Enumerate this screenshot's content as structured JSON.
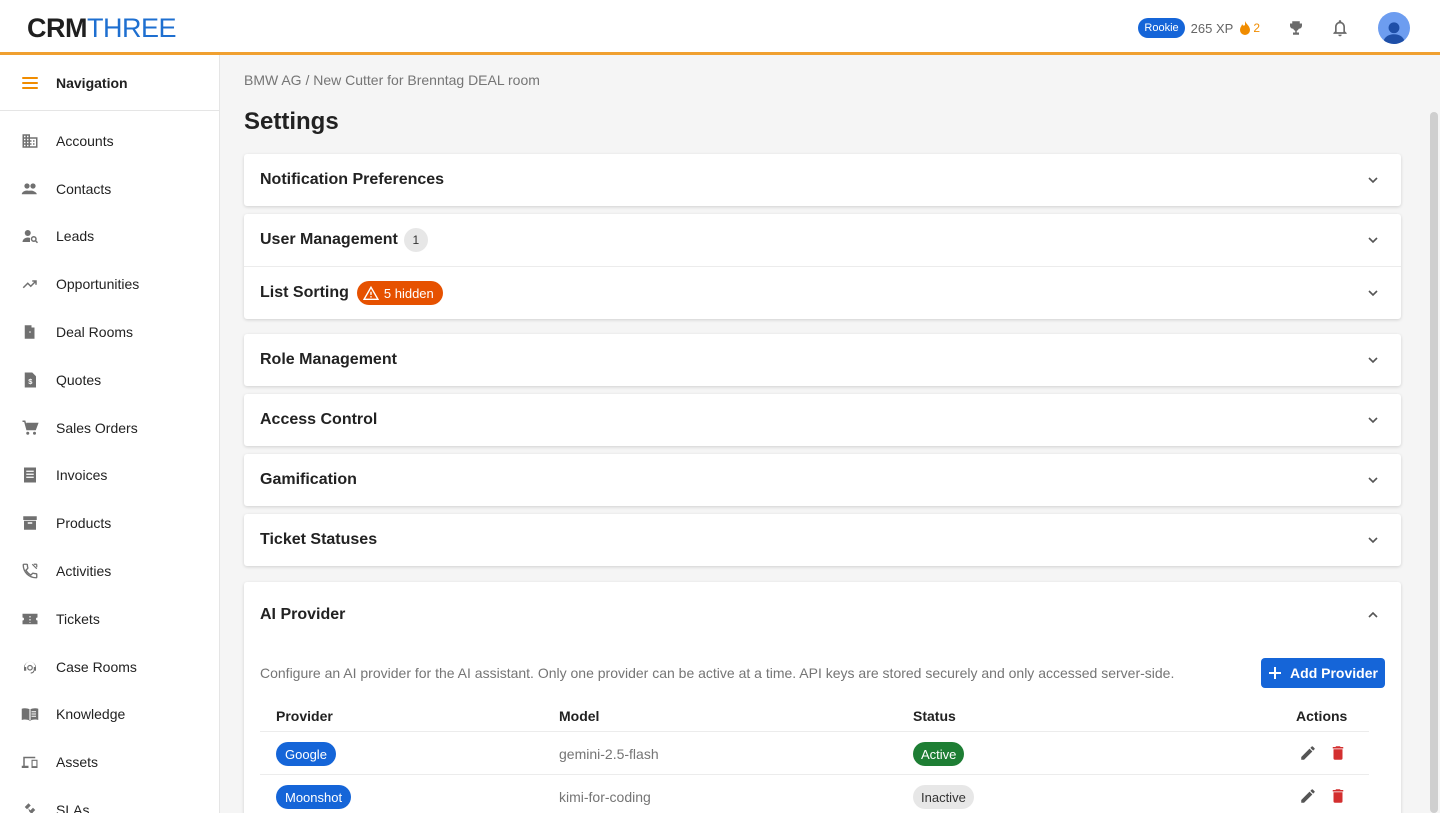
{
  "app": {
    "logo_part1": "CRM",
    "logo_part2": "THREE"
  },
  "header": {
    "rank": "Rookie",
    "xp": "265 XP",
    "streak": "2"
  },
  "sidebar": {
    "title": "Navigation",
    "items": [
      {
        "label": "Accounts",
        "icon": "building-icon"
      },
      {
        "label": "Contacts",
        "icon": "people-icon"
      },
      {
        "label": "Leads",
        "icon": "person-search-icon"
      },
      {
        "label": "Opportunities",
        "icon": "trending-up-icon"
      },
      {
        "label": "Deal Rooms",
        "icon": "door-icon"
      },
      {
        "label": "Quotes",
        "icon": "request-quote-icon"
      },
      {
        "label": "Sales Orders",
        "icon": "cart-icon"
      },
      {
        "label": "Invoices",
        "icon": "receipt-icon"
      },
      {
        "label": "Products",
        "icon": "archive-icon"
      },
      {
        "label": "Activities",
        "icon": "phone-icon"
      },
      {
        "label": "Tickets",
        "icon": "ticket-icon"
      },
      {
        "label": "Case Rooms",
        "icon": "support-agent-icon"
      },
      {
        "label": "Knowledge",
        "icon": "book-icon"
      },
      {
        "label": "Assets",
        "icon": "devices-icon"
      },
      {
        "label": "SLAs",
        "icon": "gavel-icon"
      }
    ]
  },
  "main": {
    "breadcrumb": "BMW AG / New Cutter for Brenntag DEAL room",
    "title": "Settings",
    "sections": {
      "notifications": "Notification Preferences",
      "user_management": "User Management",
      "user_management_count": "1",
      "list_sorting": "List Sorting",
      "list_sorting_badge": "5 hidden",
      "roles": "Role Management",
      "access": "Access Control",
      "gamification": "Gamification",
      "tickets": "Ticket Statuses",
      "ai": "AI Provider"
    },
    "ai": {
      "description": "Configure an AI provider for the AI assistant. Only one provider can be active at a time. API keys are stored securely and only accessed server-side.",
      "add_button": "Add Provider",
      "columns": {
        "provider": "Provider",
        "model": "Model",
        "status": "Status",
        "actions": "Actions"
      },
      "rows": [
        {
          "provider": "Google",
          "model": "gemini-2.5-flash",
          "status": "Active"
        },
        {
          "provider": "Moonshot",
          "model": "kimi-for-coding",
          "status": "Inactive"
        }
      ]
    }
  },
  "colors": {
    "accent": "#f0a030",
    "primary": "#1565d8",
    "active": "#1e7e34",
    "danger": "#d32f2f",
    "warning": "#e65100"
  }
}
